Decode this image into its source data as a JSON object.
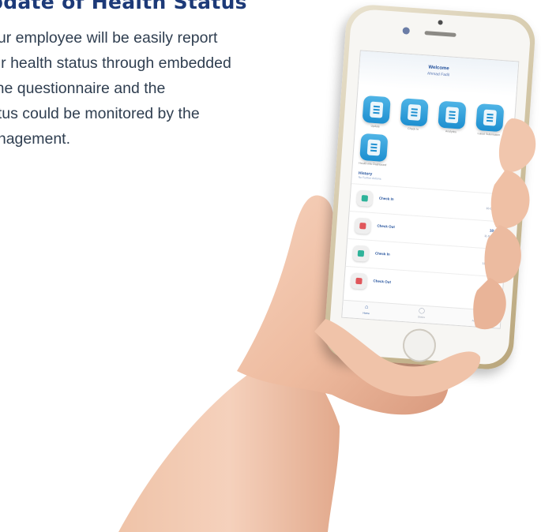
{
  "heading": "pdate of Health Status",
  "description_lines": [
    "our employee will be easily report",
    "eir health status through embedded",
    "line questionnaire and the",
    "atus could be monitored by the",
    "anagement."
  ],
  "app": {
    "header_title": "Welcome",
    "header_subtitle": "Ahmad Fadil",
    "tiles": [
      {
        "icon": "questionnaire-icon",
        "label": "Update"
      },
      {
        "icon": "check-in-icon",
        "label": "Check In"
      },
      {
        "icon": "analytics-icon",
        "label": "Analytics"
      },
      {
        "icon": "report-icon",
        "label": "Latest Submission"
      },
      {
        "icon": "history-icon",
        "label": "Health Info Dashboard"
      }
    ],
    "status_title": "History",
    "status_subtitle": "No Further Actions",
    "entries": [
      {
        "label": "Check In",
        "time": "08:41",
        "date": "10-04-2020",
        "kind": "in"
      },
      {
        "label": "Check Out",
        "time": "18:02",
        "date": "11-04-2020",
        "kind": "out"
      },
      {
        "label": "Check In",
        "time": "08:51",
        "date": "11-04-2020",
        "kind": "in"
      },
      {
        "label": "Check Out",
        "time": "18:47",
        "date": "12-04-2020",
        "kind": "out"
      }
    ],
    "nav": [
      {
        "icon": "home-icon",
        "label": "Home",
        "active": true
      },
      {
        "icon": "status-icon",
        "label": "Status",
        "active": false
      },
      {
        "icon": "account-icon",
        "label": "Account",
        "active": false
      }
    ]
  },
  "colors": {
    "heading": "#1d3a78",
    "body_text": "#2f3e50",
    "tile_blue": "#1d8fd0",
    "check_in": "#2fb39a",
    "check_out": "#e0565b",
    "phone_gold": "#cdbf9c",
    "skin": "#f2c2a8"
  }
}
